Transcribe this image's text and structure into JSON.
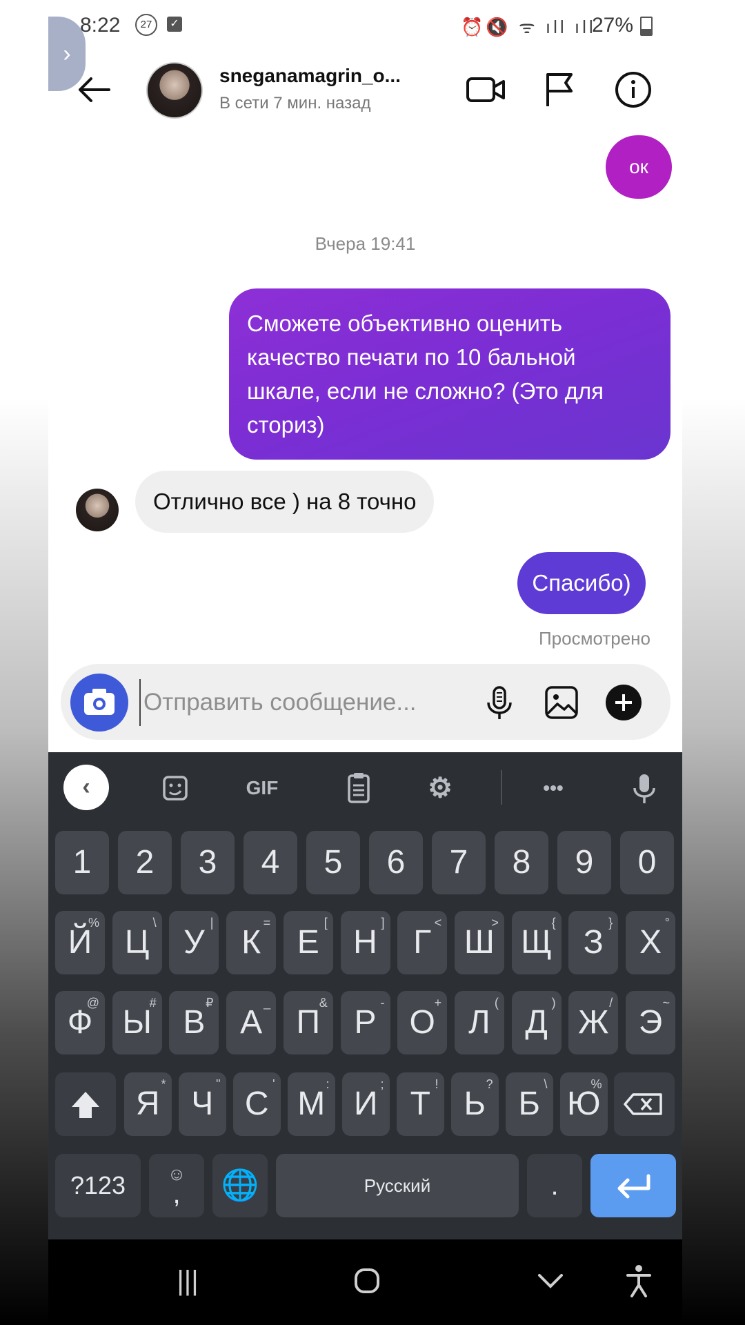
{
  "status_bar": {
    "time": "8:22",
    "badge": "27",
    "battery": "27%"
  },
  "header": {
    "username": "sneganamagrin_o...",
    "presence": "В сети 7 мин. назад"
  },
  "messages": {
    "ok": "ок",
    "date_separator": "Вчера 19:41",
    "question": "Сможете объективно оценить качество печати по 10 бальной шкале, если не сложно? (Это для сториз)",
    "reply": "Отлично все ) на 8 точно",
    "thanks": "Спасибо)",
    "seen": "Просмотрено"
  },
  "composer": {
    "placeholder": "Отправить сообщение..."
  },
  "keyboard": {
    "toolbar": {
      "gif": "GIF",
      "more": "•••"
    },
    "numbers": [
      "1",
      "2",
      "3",
      "4",
      "5",
      "6",
      "7",
      "8",
      "9",
      "0"
    ],
    "row1": [
      "Й",
      "Ц",
      "У",
      "К",
      "Е",
      "Н",
      "Г",
      "Ш",
      "Щ",
      "З",
      "Х"
    ],
    "row1_alt": [
      "%",
      "\\",
      "|",
      "=",
      "[",
      "]",
      "<",
      ">",
      "{",
      "}",
      "°"
    ],
    "row2": [
      "Ф",
      "Ы",
      "В",
      "А",
      "П",
      "Р",
      "О",
      "Л",
      "Д",
      "Ж",
      "Э"
    ],
    "row2_alt": [
      "@",
      "#",
      "₽",
      "_",
      "&",
      "-",
      "+",
      "(",
      ")",
      "/",
      "~"
    ],
    "row3": [
      "Я",
      "Ч",
      "С",
      "М",
      "И",
      "Т",
      "Ь",
      "Б",
      "Ю"
    ],
    "row3_alt": [
      "*",
      "\"",
      "'",
      ":",
      ";",
      "!",
      "?",
      "\\",
      "%"
    ],
    "symbols_label": "?123",
    "comma": ",",
    "space_label": "Русский",
    "period": "."
  },
  "colors": {
    "bubble_ok": "#b020c2",
    "bubble_question": "#7a2ed4",
    "bubble_thanks": "#5f3bd6",
    "camera_button": "#3f5ad9",
    "keyboard_bg": "#2c3035",
    "enter_key": "#5b9bf0"
  }
}
